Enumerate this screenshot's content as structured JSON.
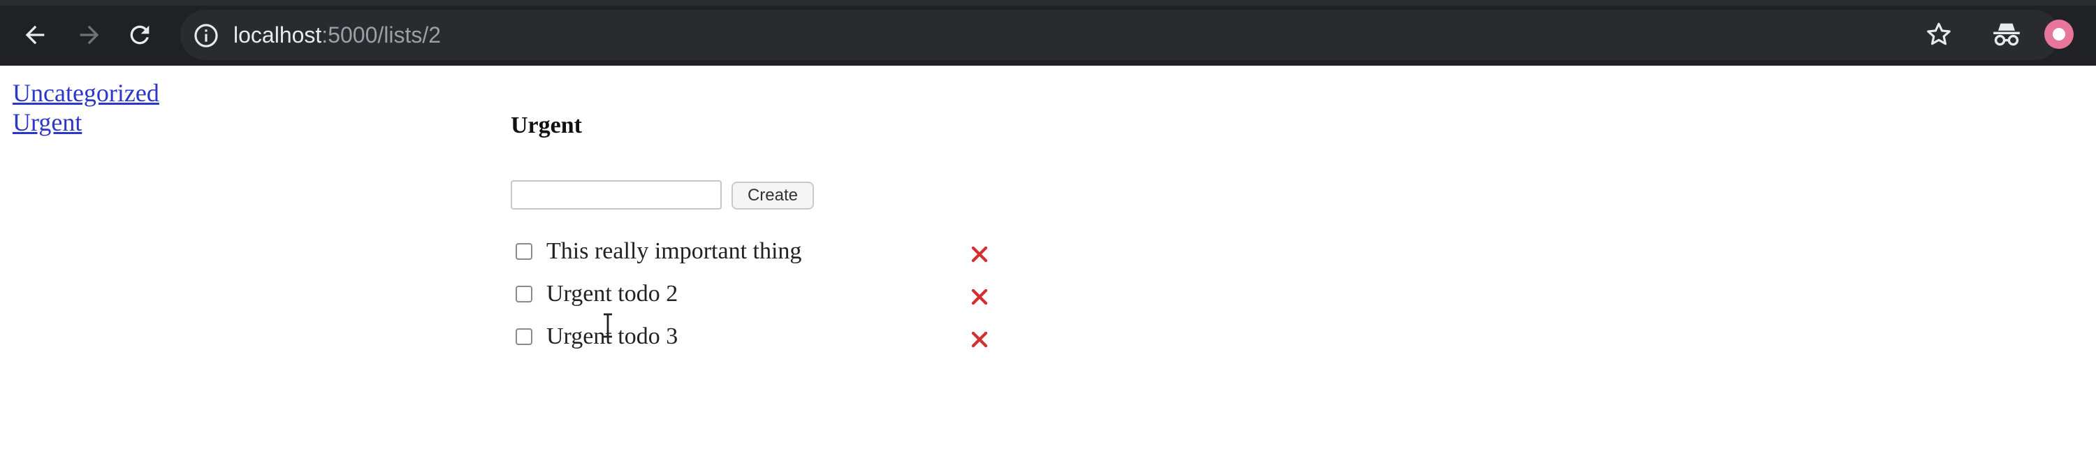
{
  "browser": {
    "url_host": "localhost",
    "url_rest": ":5000/lists/2",
    "back_icon": "arrow-left-icon",
    "forward_icon": "arrow-right-icon",
    "reload_icon": "reload-icon",
    "info_icon": "info-icon",
    "bookmark_icon": "star-icon",
    "incognito_icon": "incognito-icon",
    "profile_icon": "avatar-icon"
  },
  "sidebar": {
    "items": [
      {
        "label": "Uncategorized"
      },
      {
        "label": "Urgent"
      }
    ]
  },
  "main": {
    "title": "Urgent",
    "create_label": "Create",
    "new_todo_value": "",
    "todos": [
      {
        "text": "This really important thing",
        "completed": false
      },
      {
        "text": "Urgent todo 2",
        "completed": false
      },
      {
        "text": "Urgent todo 3",
        "completed": false
      }
    ],
    "delete_icon": "close-x-icon"
  },
  "colors": {
    "chrome_bg": "#202124",
    "link": "#2b37c9",
    "delete": "#d32f2f"
  }
}
